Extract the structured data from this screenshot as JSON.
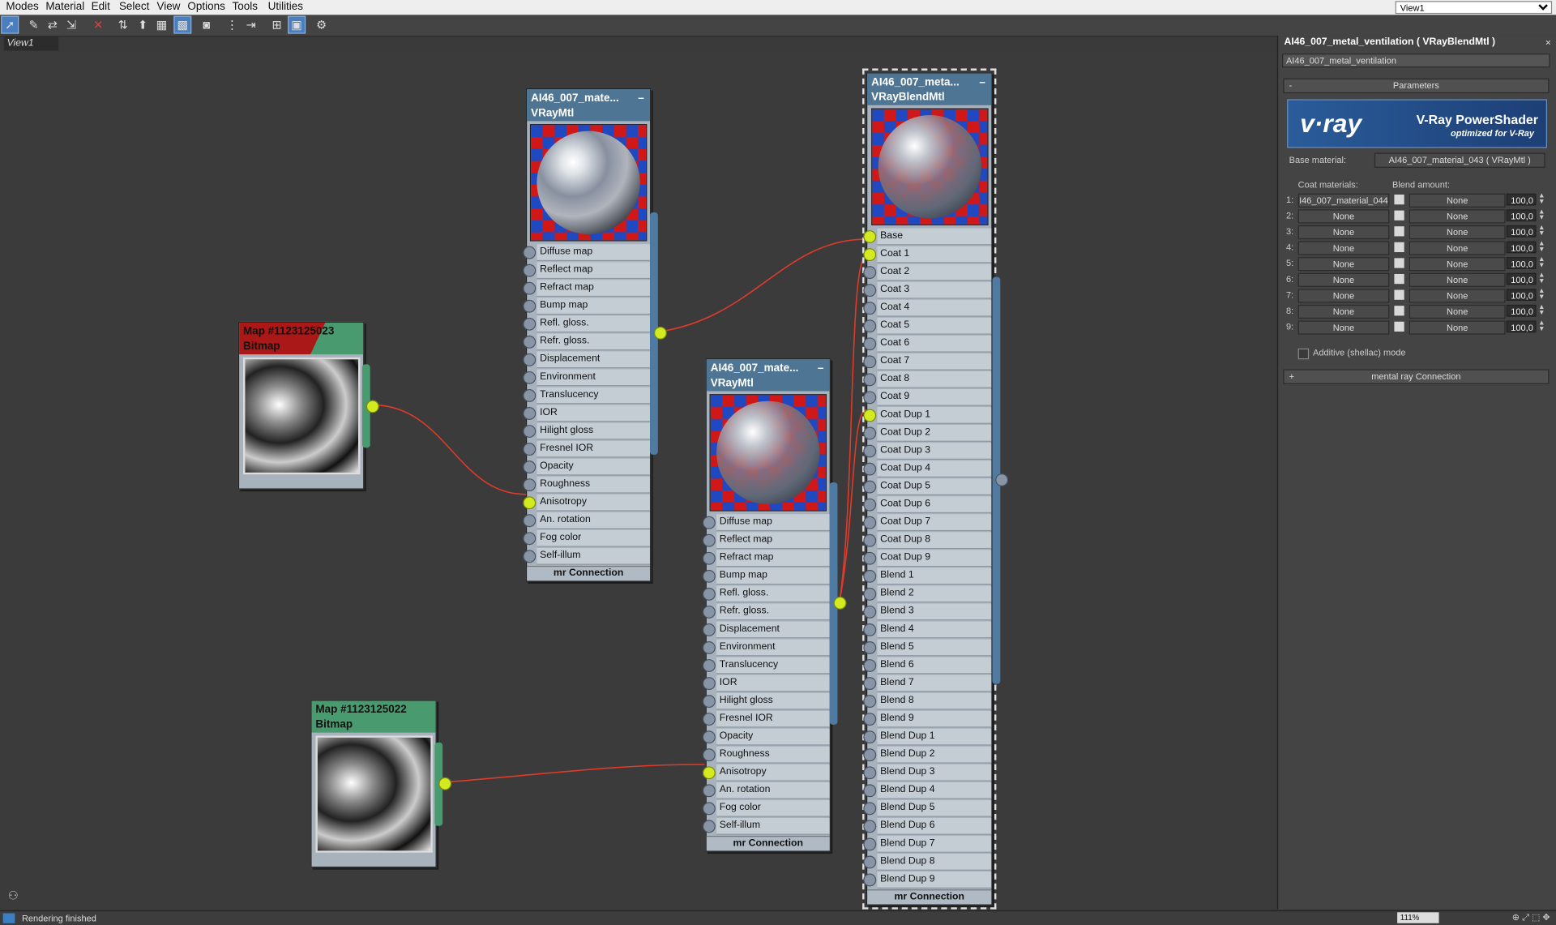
{
  "menu": [
    "Modes",
    "Material",
    "Edit",
    "Select",
    "View",
    "Options",
    "Tools",
    "Utilities"
  ],
  "view_selector": "View1",
  "view_tab": "View1",
  "nodes": {
    "mat043": {
      "title": "AI46_007_mate...",
      "type": "VRayMtl"
    },
    "mat044": {
      "title": "AI46_007_mate...",
      "type": "VRayMtl"
    },
    "blend": {
      "title": "AI46_007_meta...",
      "type": "VRayBlendMtl"
    },
    "map023": {
      "title": "Map #1123125023",
      "type": "Bitmap"
    },
    "map022": {
      "title": "Map #1123125022",
      "type": "Bitmap"
    }
  },
  "vray_slots": [
    "Diffuse map",
    "Reflect map",
    "Refract map",
    "Bump map",
    "Refl. gloss.",
    "Refr. gloss.",
    "Displacement",
    "Environment",
    "Translucency",
    "IOR",
    "Hilight gloss",
    "Fresnel IOR",
    "Opacity",
    "Roughness",
    "Anisotropy",
    "An. rotation",
    "Fog color",
    "Self-illum"
  ],
  "blend_slots": [
    "Base",
    "Coat 1",
    "Coat 2",
    "Coat 3",
    "Coat 4",
    "Coat 5",
    "Coat 6",
    "Coat 7",
    "Coat 8",
    "Coat 9",
    "Coat Dup 1",
    "Coat Dup 2",
    "Coat Dup 3",
    "Coat Dup 4",
    "Coat Dup 5",
    "Coat Dup 6",
    "Coat Dup 7",
    "Coat Dup 8",
    "Coat Dup 9",
    "Blend 1",
    "Blend 2",
    "Blend 3",
    "Blend 4",
    "Blend 5",
    "Blend 6",
    "Blend 7",
    "Blend 8",
    "Blend 9",
    "Blend Dup 1",
    "Blend Dup 2",
    "Blend Dup 3",
    "Blend Dup 4",
    "Blend Dup 5",
    "Blend Dup 6",
    "Blend Dup 7",
    "Blend Dup 8",
    "Blend Dup 9"
  ],
  "footer": "mr Connection",
  "panel": {
    "title": "AI46_007_metal_ventilation  ( VRayBlendMtl )",
    "name": "AI46_007_metal_ventilation",
    "params_rollout": "Parameters",
    "params_toggle": "-",
    "logo_left": "v·ray",
    "logo_title": "V-Ray PowerShader",
    "logo_sub": "optimized for V-Ray",
    "base_label": "Base material:",
    "base_value": "AI46_007_material_043  ( VRayMtl )",
    "coat_label": "Coat materials:",
    "blend_label": "Blend amount:",
    "coats": [
      {
        "n": "1:",
        "m": "I46_007_material_044",
        "b": "None",
        "v": "100,0"
      },
      {
        "n": "2:",
        "m": "None",
        "b": "None",
        "v": "100,0"
      },
      {
        "n": "3:",
        "m": "None",
        "b": "None",
        "v": "100,0"
      },
      {
        "n": "4:",
        "m": "None",
        "b": "None",
        "v": "100,0"
      },
      {
        "n": "5:",
        "m": "None",
        "b": "None",
        "v": "100,0"
      },
      {
        "n": "6:",
        "m": "None",
        "b": "None",
        "v": "100,0"
      },
      {
        "n": "7:",
        "m": "None",
        "b": "None",
        "v": "100,0"
      },
      {
        "n": "8:",
        "m": "None",
        "b": "None",
        "v": "100,0"
      },
      {
        "n": "9:",
        "m": "None",
        "b": "None",
        "v": "100,0"
      }
    ],
    "additive": "Additive (shellac) mode",
    "mr_rollout": "mental ray Connection",
    "mr_toggle": "+"
  },
  "status": {
    "text": "Rendering finished",
    "zoom": "111%"
  },
  "colors": {
    "wire": "#e03a2a",
    "active_socket": "#d4ea20",
    "vray_header": "#4e7694",
    "bitmap_header": "#4a9a70"
  }
}
